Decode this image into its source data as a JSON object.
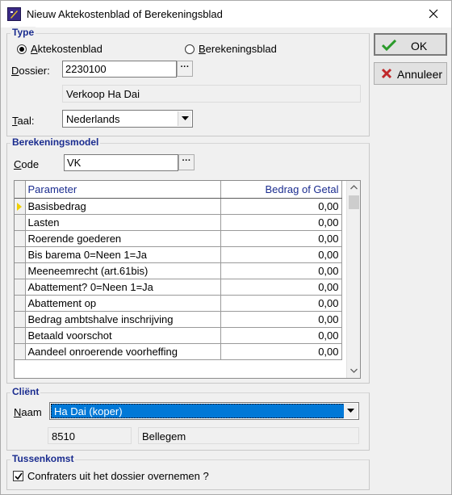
{
  "window": {
    "title": "Nieuw Aktekostenblad of Berekeningsblad"
  },
  "type_group": {
    "title": "Type",
    "radio_aktekosten": "Aktekostenblad",
    "radio_berekening": "Berekeningsblad",
    "selected": "Aktekostenblad",
    "dossier_label_mnemonic": "D",
    "dossier_label_rest": "ossier:",
    "dossier_value": "2230100",
    "dossier_name": "Verkoop Ha Dai",
    "taal_label_mnemonic": "T",
    "taal_label_rest": "aal:",
    "taal_value": "Nederlands"
  },
  "berekeningsmodel": {
    "title": "Berekeningsmodel",
    "code_label_mnemonic": "C",
    "code_label_rest": "ode",
    "code_value": "VK",
    "columns": [
      "Parameter",
      "Bedrag of Getal"
    ],
    "rows": [
      {
        "parameter": "Basisbedrag",
        "value": "0,00"
      },
      {
        "parameter": "Lasten",
        "value": "0,00"
      },
      {
        "parameter": "Roerende goederen",
        "value": "0,00"
      },
      {
        "parameter": "Bis barema 0=Neen 1=Ja",
        "value": "0,00"
      },
      {
        "parameter": "Meeneemrecht (art.61bis)",
        "value": "0,00"
      },
      {
        "parameter": "Abattement? 0=Neen 1=Ja",
        "value": "0,00"
      },
      {
        "parameter": "Abattement op",
        "value": "0,00"
      },
      {
        "parameter": "Bedrag ambtshalve inschrijving",
        "value": "0,00"
      },
      {
        "parameter": "Betaald voorschot",
        "value": "0,00"
      },
      {
        "parameter": "Aandeel onroerende voorheffing",
        "value": "0,00"
      }
    ]
  },
  "client": {
    "title": "Cliënt",
    "naam_label_mnemonic": "N",
    "naam_label_rest": "aam",
    "naam_value": "Ha Dai (koper)",
    "postcode": "8510",
    "gemeente": "Bellegem"
  },
  "tussenkomst": {
    "title": "Tussenkomst",
    "checkbox_label": "Confraters uit het dossier overnemen ?",
    "checked": true
  },
  "buttons": {
    "ok": "OK",
    "cancel": "Annuleer"
  },
  "colors": {
    "group_title": "#1a2c8f",
    "selection": "#0078d7",
    "ok_check": "#2a9a2a",
    "cancel_x": "#c0282a"
  }
}
